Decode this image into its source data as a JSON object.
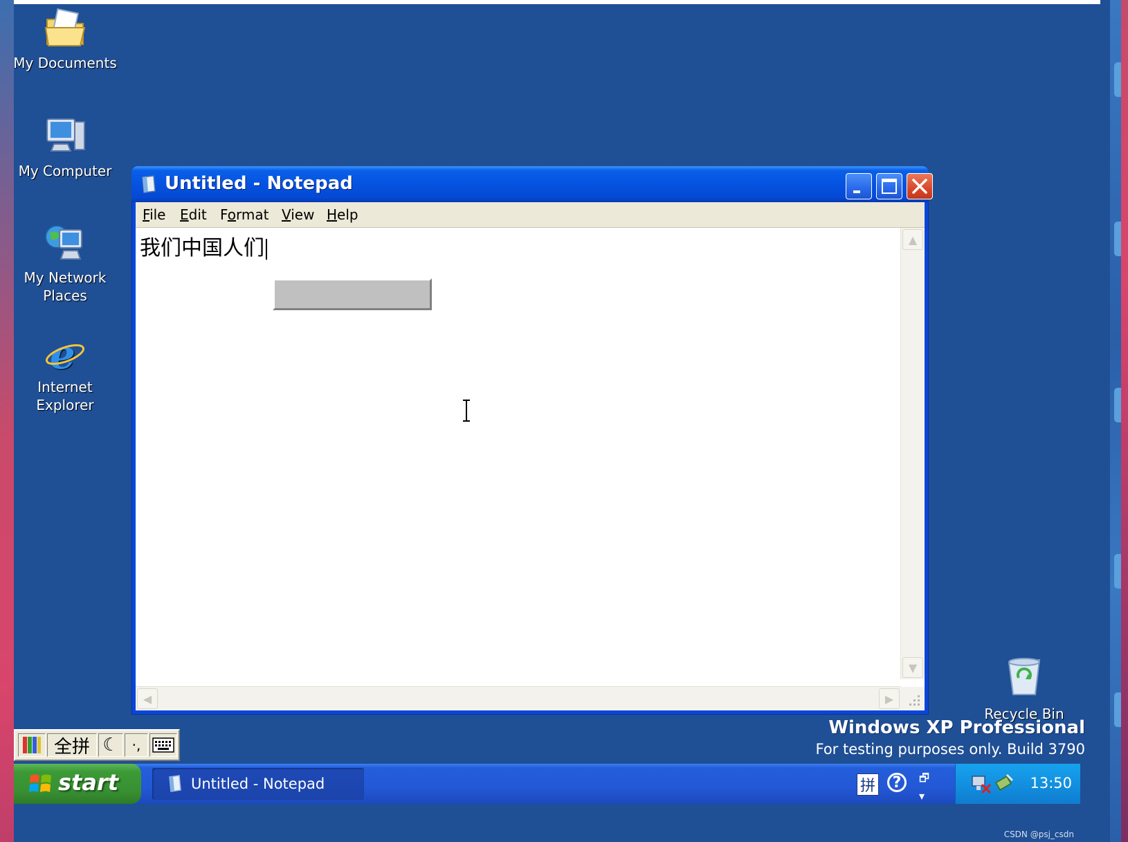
{
  "desktop": {
    "icons": [
      {
        "label": "My Documents"
      },
      {
        "label": "My Computer"
      },
      {
        "label": "My Network Places"
      },
      {
        "label": "Internet Explorer"
      }
    ],
    "recycle_bin": "Recycle Bin",
    "watermark": {
      "edition": "Windows XP Professional",
      "build": "For testing purposes only. Build 3790"
    }
  },
  "window": {
    "title": "Untitled - Notepad",
    "menu": [
      {
        "label": "File",
        "accel": "F",
        "rest": "ile"
      },
      {
        "label": "Edit",
        "accel": "E",
        "rest": "dit"
      },
      {
        "label": "Format",
        "accel": "o",
        "pre": "F",
        "rest": "rmat"
      },
      {
        "label": "View",
        "accel": "V",
        "rest": "iew"
      },
      {
        "label": "Help",
        "accel": "H",
        "rest": "elp"
      }
    ],
    "content": "我们中国人们"
  },
  "ime_toolbar": {
    "mode": "全拼"
  },
  "taskbar": {
    "start_label": "start",
    "task_label": "Untitled - Notepad",
    "tray_ime": "拼",
    "tray_help": "?",
    "clock": "13:50",
    "credit": "CSDN @psj_csdn"
  },
  "colors": {
    "desktop": "#1f4f95",
    "titlebar": "#0553e1",
    "menubar": "#ece9d8",
    "start": "#3c9a36",
    "tray": "#1390e0"
  }
}
